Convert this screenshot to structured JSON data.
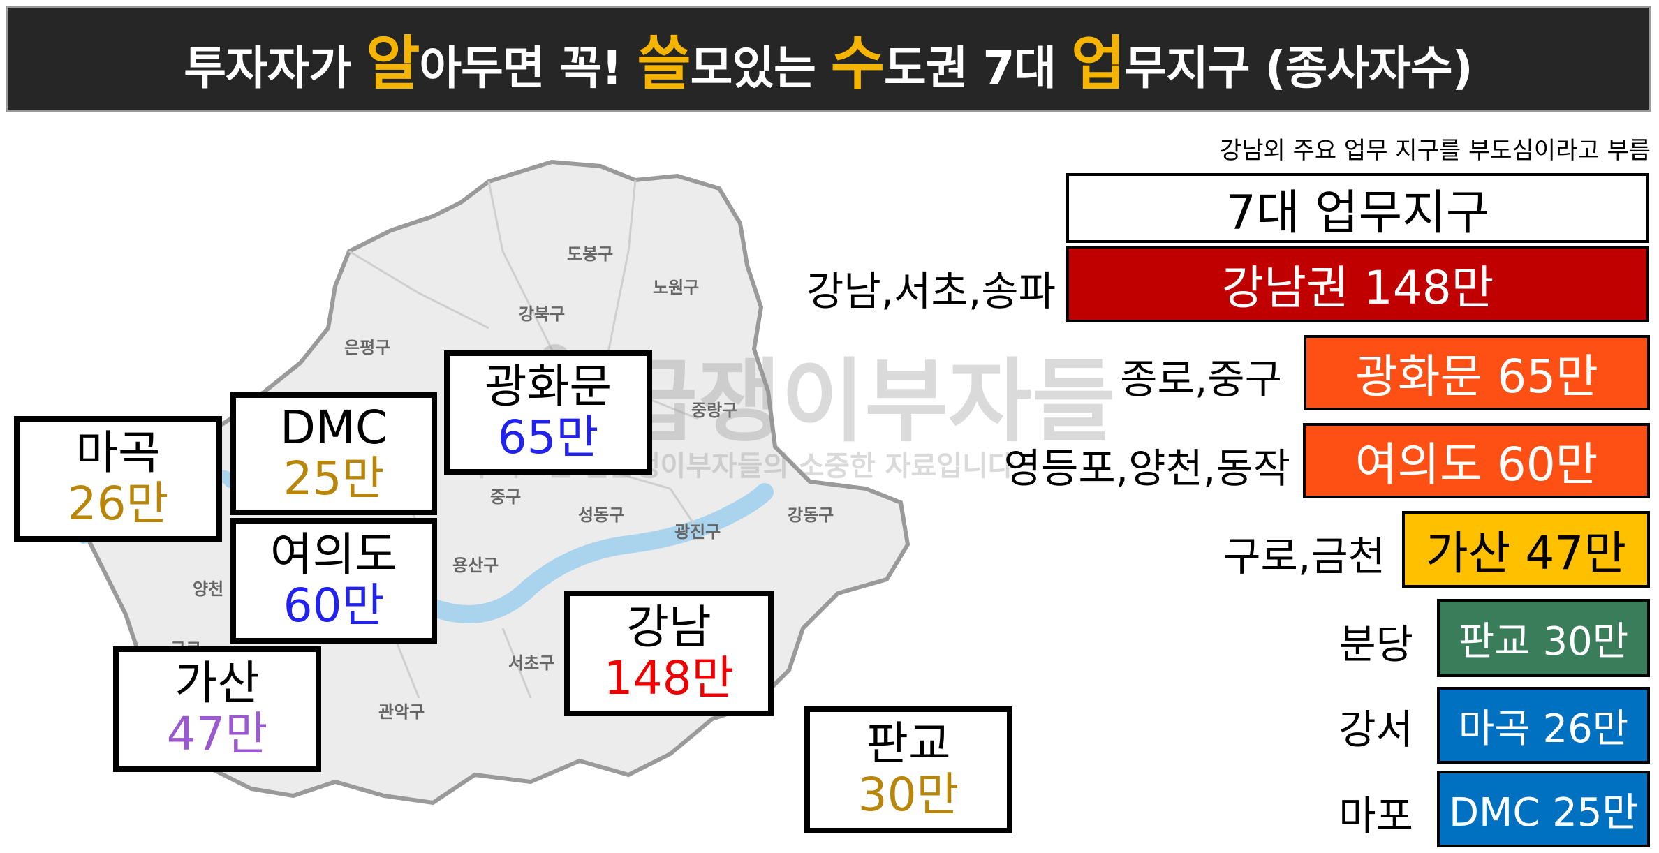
{
  "title": {
    "p1": "투자자가 ",
    "h1": "알",
    "p2": "아두면 꼭! ",
    "h2": "쓸",
    "p3": "모있는 ",
    "h3": "수",
    "p4": "도권 7대 ",
    "h4": "업",
    "p5": "무지구 (종사자수)"
  },
  "colors": {
    "title_bg": "#262626",
    "title_highlight": "#f5b400",
    "gangnam": "#c00000",
    "gwanghwamun": "#fe5014",
    "yeouido": "#fe5014",
    "gasan": "#ffc000",
    "pangyo": "#3a7d5a",
    "magok": "#0070c0",
    "dmc": "#0070c0"
  },
  "map": {
    "districts": [
      "도봉구",
      "노원구",
      "강북구",
      "은평구",
      "중랑구",
      "중구",
      "성동구",
      "광진구",
      "강동구",
      "용산구",
      "서초구",
      "관악구",
      "양천",
      "구로"
    ],
    "watermark": "월급쟁이부자들",
    "watermark_sub": "이 자료는 월급쟁이부자들의 소중한 자료입니다",
    "callouts": [
      {
        "name": "마곡",
        "value": "26만",
        "color": "#b8860b"
      },
      {
        "name": "DMC",
        "value": "25만",
        "color": "#b8860b"
      },
      {
        "name": "광화문",
        "value": "65만",
        "color": "#2222ee"
      },
      {
        "name": "여의도",
        "value": "60만",
        "color": "#2222ee"
      },
      {
        "name": "가산",
        "value": "47만",
        "color": "#9b59d0"
      },
      {
        "name": "강남",
        "value": "148만",
        "color": "#ee0000"
      },
      {
        "name": "판교",
        "value": "30만",
        "color": "#b8860b"
      }
    ]
  },
  "legend": {
    "note": "강남외 주요 업무 지구를 부도심이라고 부름",
    "header": "7대 업무지구",
    "rows": [
      {
        "area": "강남,서초,송파",
        "label": "강남권 148만",
        "color": "#c00000",
        "text_color": "#ffffff"
      },
      {
        "area": "종로,중구",
        "label": "광화문 65만",
        "color": "#fe5014",
        "text_color": "#ffffff"
      },
      {
        "area": "영등포,양천,동작",
        "label": "여의도 60만",
        "color": "#fe5014",
        "text_color": "#ffffff"
      },
      {
        "area": "구로,금천",
        "label": "가산 47만",
        "color": "#ffc000",
        "text_color": "#000000"
      },
      {
        "area": "분당",
        "label": "판교 30만",
        "color": "#3a7d5a",
        "text_color": "#ffffff"
      },
      {
        "area": "강서",
        "label": "마곡 26만",
        "color": "#0070c0",
        "text_color": "#ffffff"
      },
      {
        "area": "마포",
        "label": "DMC 25만",
        "color": "#0070c0",
        "text_color": "#ffffff"
      }
    ]
  }
}
